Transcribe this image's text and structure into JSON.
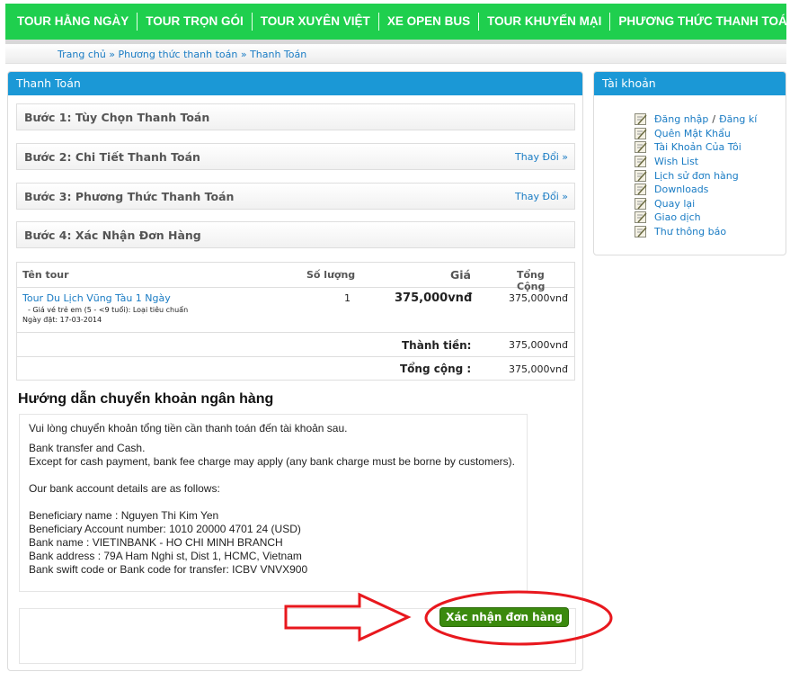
{
  "nav": [
    "TOUR HẰNG NGÀY",
    "TOUR TRỌN GÓI",
    "TOUR XUYÊN VIỆT",
    "XE OPEN BUS",
    "TOUR KHUYẾN MẠI",
    "PHƯƠNG THỨC THANH TOÁN"
  ],
  "breadcrumb": {
    "home": "Trang chủ",
    "sep": " » ",
    "payment_methods": "Phương thức thanh toán",
    "current": "Thanh Toán"
  },
  "main": {
    "title": "Thanh Toán",
    "steps": [
      {
        "label": "Bước 1: Tùy Chọn Thanh Toán",
        "link": ""
      },
      {
        "label": "Bước 2: Chi Tiết Thanh Toán",
        "link": "Thay Đổi »"
      },
      {
        "label": "Bước 3: Phương Thức Thanh Toán",
        "link": "Thay Đổi »"
      },
      {
        "label": "Bước 4: Xác Nhận Đơn Hàng",
        "link": ""
      }
    ],
    "order": {
      "headers": {
        "tour": "Tên tour",
        "qty": "Số lượng",
        "price": "Giá",
        "total": "Tổng Cộng"
      },
      "item": {
        "name": "Tour Du Lịch Vũng Tàu 1 Ngày",
        "option": "- Giá vé trẻ em (5 - <9 tuổi): Loại tiêu chuẩn",
        "date": "Ngày đặt: 17-03-2014",
        "qty": "1",
        "price": "375,000vnđ",
        "total": "375,000vnđ"
      },
      "subtotal_label": "Thành tiền:",
      "subtotal": "375,000vnđ",
      "grand_label": "Tổng cộng :",
      "grand": "375,000vnđ"
    },
    "guide": {
      "title": "Hướng dẫn chuyển khoản ngân hàng",
      "intro": "Vui lòng chuyển khoản tổng tiền cần thanh toán đến tài khoản sau.",
      "line1": "Bank transfer and Cash.",
      "line2": "Except for cash payment, bank fee charge may apply (any bank charge must be borne by customers).",
      "details_head": "Our bank account details are as follows:",
      "beneficiary": "Beneficiary name : Nguyen Thi Kim Yen",
      "account": "Beneficiary Account number: 1010 20000 4701 24 (USD)",
      "bank": "Bank name : VIETINBANK - HO CHI MINH BRANCH",
      "address": "Bank address : 79A Ham Nghi st, Dist 1, HCMC, Vietnam",
      "swift": "Bank swift code or Bank code for transfer: ICBV VNVX900"
    },
    "confirm_button": "Xác nhận đơn hàng"
  },
  "sidebar": {
    "title": "Tài khoản",
    "login": "Đăng nhập",
    "slash": "/",
    "register": "Đăng kí",
    "items": [
      "Quên Mật Khẩu",
      "Tài Khoản Của Tôi",
      "Wish List",
      "Lịch sử đơn hàng",
      "Downloads",
      "Quay lại",
      "Giao dịch",
      "Thư thông báo"
    ]
  },
  "colors": {
    "nav_green": "#1fcf4e",
    "header_blue": "#1b98d6",
    "button_green": "#3b8a0e",
    "annotation_red": "#e8181e"
  }
}
